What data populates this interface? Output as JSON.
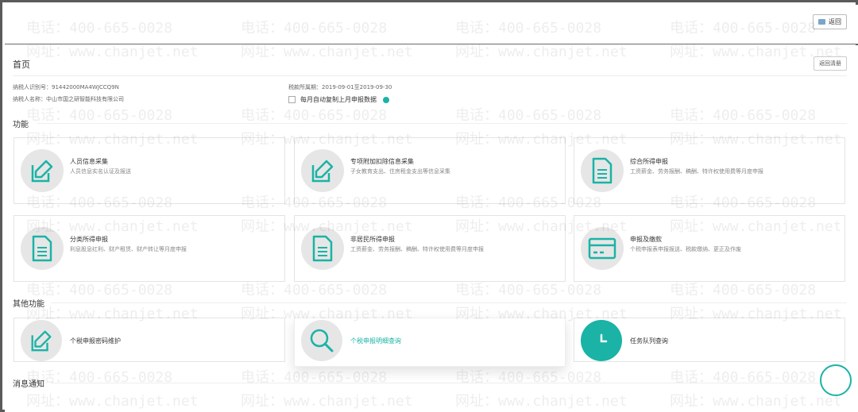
{
  "topbar": {
    "back_label": "返回"
  },
  "page": {
    "title": "首页",
    "reset_label": "返回清册",
    "taxpayer_id_label": "纳税人识别号：",
    "taxpayer_id": "91442000MA4WJCCQ9N",
    "taxpayer_name_label": "纳税人名称：",
    "taxpayer_name": "中山市国之研智能科技有限公司",
    "period_label": "税款所属期：",
    "period": "2019-09-01至2019-09-30",
    "auto_copy_label": "每月自动复制上月申报数据"
  },
  "functions": {
    "title": "功能",
    "cards": [
      {
        "title": "人员信息采集",
        "desc": "人员信息实名认证及报送",
        "icon": "edit-icon"
      },
      {
        "title": "专项附加扣除信息采集",
        "desc": "子女教育支出、住房租金支出等信息采集",
        "icon": "edit-icon"
      },
      {
        "title": "综合所得申报",
        "desc": "工资薪金、劳务报酬、稿酬、特许权使用费等月度申报",
        "icon": "document-icon"
      },
      {
        "title": "分类所得申报",
        "desc": "利息股息红利、财产租赁、财产转让等月度申报",
        "icon": "document-icon"
      },
      {
        "title": "非居民所得申报",
        "desc": "工资薪金、劳务报酬、稿酬、特许权使用费等月度申报",
        "icon": "document-icon"
      },
      {
        "title": "申报及缴款",
        "desc": "个税申报表申报报送、税款缴纳、更正及作废",
        "icon": "card-icon"
      }
    ]
  },
  "other_functions": {
    "title": "其他功能",
    "cards": [
      {
        "title": "个税申报密码维护",
        "icon": "edit-icon"
      },
      {
        "title": "个税申报明细查询",
        "icon": "search-icon"
      },
      {
        "title": "任务队列查询",
        "icon": "clock-icon"
      }
    ]
  },
  "messages": {
    "title": "消息通知"
  },
  "watermark": {
    "phone": "电话：400-665-0028",
    "site": "网址：www.chanjet.net"
  },
  "colors": {
    "accent": "#1ab3a6",
    "icon_bg": "#e6e6e6",
    "border": "#5a5a5a"
  }
}
